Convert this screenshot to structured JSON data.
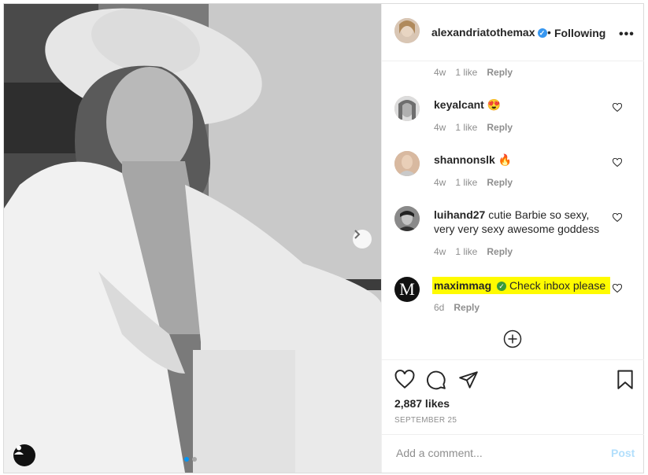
{
  "post": {
    "author": "alexandriatothemax",
    "header_separator": "•",
    "follow_status": "Following",
    "more_icon": "•••",
    "likes": "2,887 likes",
    "date": "SEPTEMBER 25"
  },
  "carousel": {
    "total": 2,
    "active": 0
  },
  "comments": [
    {
      "username": "",
      "text": "",
      "age": "4w",
      "likes": "1 like",
      "reply": "Reply",
      "partial": true
    },
    {
      "username": "keyalcant",
      "text": "😍",
      "age": "4w",
      "likes": "1 like",
      "reply": "Reply"
    },
    {
      "username": "shannonslk",
      "text": "🔥",
      "age": "4w",
      "likes": "1 like",
      "reply": "Reply"
    },
    {
      "username": "luihand27",
      "text": "cutie Barbie so sexy, very very sexy awesome goddess",
      "age": "4w",
      "likes": "1 like",
      "reply": "Reply"
    },
    {
      "username": "maximmag",
      "text": "Check inbox please",
      "age": "6d",
      "likes": "",
      "reply": "Reply",
      "verified": true,
      "highlighted": true,
      "avatar_letter": "M"
    }
  ],
  "add_comment": {
    "placeholder": "Add a comment...",
    "post_label": "Post"
  },
  "colors": {
    "verified": "#3897f0",
    "highlight": "#fffb00",
    "post_disabled": "#b2dffc"
  }
}
